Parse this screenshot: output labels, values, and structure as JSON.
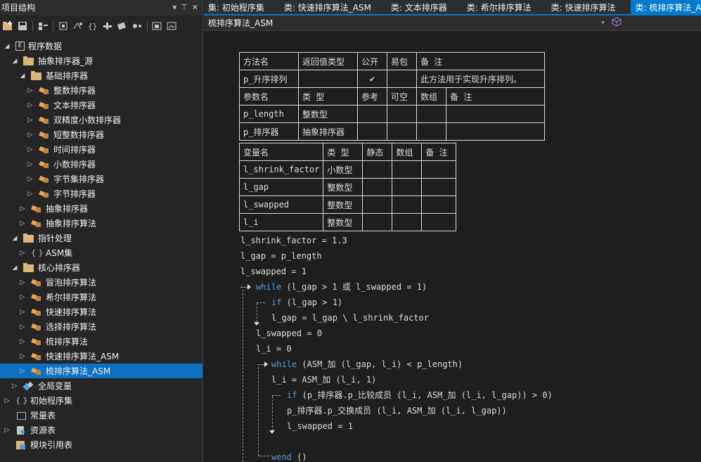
{
  "panel": {
    "title": "项目结构",
    "pin": "⊤",
    "close": "✕",
    "menu": "▾"
  },
  "tree": [
    {
      "label": "程序数据",
      "indent": 0,
      "icon": "module-icon",
      "expander": "expanded"
    },
    {
      "label": "抽象排序器_源",
      "indent": 1,
      "icon": "folder-icon",
      "expander": "expanded"
    },
    {
      "label": "基础排序器",
      "indent": 2,
      "icon": "folder-icon",
      "expander": "expanded"
    },
    {
      "label": "整数排序器",
      "indent": 3,
      "icon": "class-icon",
      "expander": "collapsed"
    },
    {
      "label": "文本排序器",
      "indent": 3,
      "icon": "class-icon",
      "expander": "collapsed"
    },
    {
      "label": "双精度小数排序器",
      "indent": 3,
      "icon": "class-icon",
      "expander": "collapsed"
    },
    {
      "label": "短整数排序器",
      "indent": 3,
      "icon": "class-icon",
      "expander": "collapsed"
    },
    {
      "label": "时间排序器",
      "indent": 3,
      "icon": "class-icon",
      "expander": "collapsed"
    },
    {
      "label": "小数排序器",
      "indent": 3,
      "icon": "class-icon",
      "expander": "collapsed"
    },
    {
      "label": "字节集排序器",
      "indent": 3,
      "icon": "class-icon",
      "expander": "collapsed"
    },
    {
      "label": "字节排序器",
      "indent": 3,
      "icon": "class-icon",
      "expander": "collapsed"
    },
    {
      "label": "抽象排序器",
      "indent": 2,
      "icon": "class-icon",
      "expander": "collapsed"
    },
    {
      "label": "抽象排序算法",
      "indent": 2,
      "icon": "class-icon",
      "expander": "collapsed"
    },
    {
      "label": "指针处理",
      "indent": 1,
      "icon": "folder-icon",
      "expander": "expanded"
    },
    {
      "label": "ASM集",
      "indent": 2,
      "icon": "brace-icon",
      "expander": "collapsed"
    },
    {
      "label": "核心排序器",
      "indent": 1,
      "icon": "folder-icon",
      "expander": "expanded"
    },
    {
      "label": "冒泡排序算法",
      "indent": 2,
      "icon": "class-icon",
      "expander": "collapsed"
    },
    {
      "label": "希尔排序算法",
      "indent": 2,
      "icon": "class-icon",
      "expander": "collapsed"
    },
    {
      "label": "快速排序算法",
      "indent": 2,
      "icon": "class-icon",
      "expander": "collapsed"
    },
    {
      "label": "选择排序算法",
      "indent": 2,
      "icon": "class-icon",
      "expander": "collapsed"
    },
    {
      "label": "梳排序算法",
      "indent": 2,
      "icon": "class-icon",
      "expander": "collapsed"
    },
    {
      "label": "快速排序算法_ASM",
      "indent": 2,
      "icon": "class-icon",
      "expander": "collapsed"
    },
    {
      "label": "梳排序算法_ASM",
      "indent": 2,
      "icon": "class-icon",
      "expander": "collapsed",
      "selected": true
    },
    {
      "label": "全局变量",
      "indent": 1,
      "icon": "global-icon",
      "expander": "collapsed"
    },
    {
      "label": "初始程序集",
      "indent": 0,
      "icon": "brace-icon",
      "expander": "collapsed"
    },
    {
      "label": "常量表",
      "indent": 0,
      "icon": "const-icon",
      "expander": "none"
    },
    {
      "label": "资源表",
      "indent": 0,
      "icon": "resource-icon",
      "expander": "collapsed"
    },
    {
      "label": "模块引用表",
      "indent": 0,
      "icon": "module-ref-icon",
      "expander": "none"
    }
  ],
  "tabs": [
    {
      "label": "集: 初始程序集"
    },
    {
      "label": "类: 快速排序算法_ASM"
    },
    {
      "label": "类: 文本排序器"
    },
    {
      "label": "类: 希尔排序算法"
    },
    {
      "label": "类: 快速排序算法"
    },
    {
      "label": "类: 梳排序算法_ASM",
      "active": true
    }
  ],
  "nav": {
    "method": "梳排序算法_ASM"
  },
  "method_table": {
    "headers": [
      "方法名",
      "返回值类型",
      "公开",
      "易包",
      "备 注"
    ],
    "row": {
      "name": "p_升序排列",
      "return": "",
      "public": "✔",
      "easy": "",
      "note": "此方法用于实现升序排列。"
    },
    "param_headers": [
      "参数名",
      "类 型",
      "参考",
      "可空",
      "数组",
      "备 注"
    ],
    "params": [
      {
        "name": "p_length",
        "type": "整数型"
      },
      {
        "name": "p_排序器",
        "type": "抽象排序器"
      }
    ]
  },
  "var_table": {
    "headers": [
      "变量名",
      "类 型",
      "静态",
      "数组",
      "备 注"
    ],
    "vars": [
      {
        "name": "l_shrink_factor",
        "type": "小数型"
      },
      {
        "name": "l_gap",
        "type": "整数型"
      },
      {
        "name": "l_swapped",
        "type": "整数型"
      },
      {
        "name": "l_i",
        "type": "整数型"
      }
    ]
  },
  "code": {
    "l1": "l_shrink_factor = 1.3",
    "l2": "l_gap = p_length",
    "l3": "l_swapped = 1",
    "while1_kw": "while",
    "while1_cond": " (l_gap > 1 或 l_swapped = 1)",
    "if1_kw": "if",
    "if1_cond": " (l_gap > 1)",
    "l4": "l_gap = l_gap \\ l_shrink_factor",
    "l5": "l_swapped = 0",
    "l6": "l_i = 0",
    "while2_kw": "while",
    "while2_cond": " (ASM_加 (l_gap, l_i) < p_length)",
    "l7": "l_i = ASM_加 (l_i, 1)",
    "if2_kw": "if",
    "if2_cond": " (p_排序器.p_比较成员 (l_i, ASM_加 (l_i, l_gap)) > 0)",
    "l8": "p_排序器.p_交换成员 (l_i, ASM_加 (l_i, l_gap))",
    "l9": "l_swapped = 1",
    "wend_kw": "wend",
    "wend_args": " ()"
  }
}
